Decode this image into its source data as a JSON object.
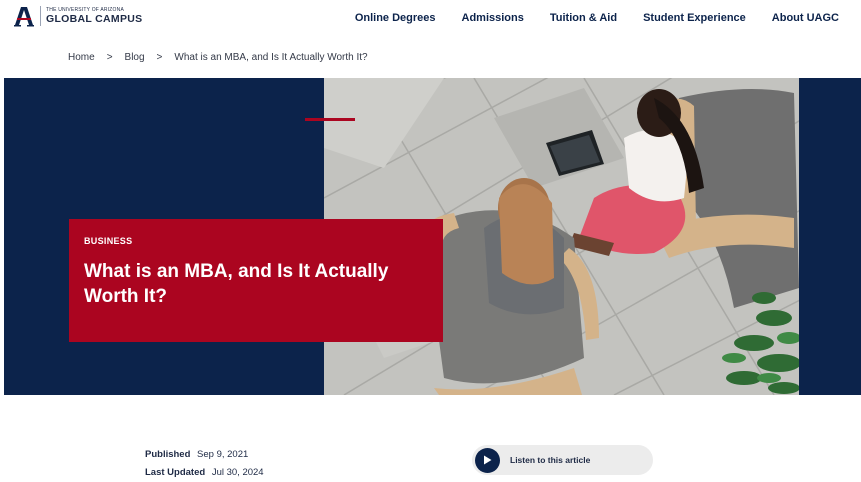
{
  "brand": {
    "small_text": "THE UNIVERSITY OF ARIZONA",
    "big_text": "GLOBAL CAMPUS",
    "colors": {
      "navy": "#0c234b",
      "red": "#ab0520"
    }
  },
  "nav": {
    "items": [
      {
        "label": "Online Degrees"
      },
      {
        "label": "Admissions"
      },
      {
        "label": "Tuition & Aid"
      },
      {
        "label": "Student Experience"
      },
      {
        "label": "About UAGC"
      }
    ]
  },
  "breadcrumb": {
    "items": [
      "Home",
      "Blog",
      "What is an MBA, and Is It Actually Worth It?"
    ],
    "separator": ">"
  },
  "hero": {
    "category": "BUSINESS",
    "title": "What is an MBA, and Is It Actually Worth It?",
    "image_icon": "photo-two-women-meeting-on-lounge-chairs"
  },
  "meta": {
    "published_label": "Published",
    "published_date": "Sep 9, 2021",
    "updated_label": "Last Updated",
    "updated_date": "Jul 30, 2024"
  },
  "audio": {
    "label": "Listen to this article",
    "icon": "play-icon"
  }
}
